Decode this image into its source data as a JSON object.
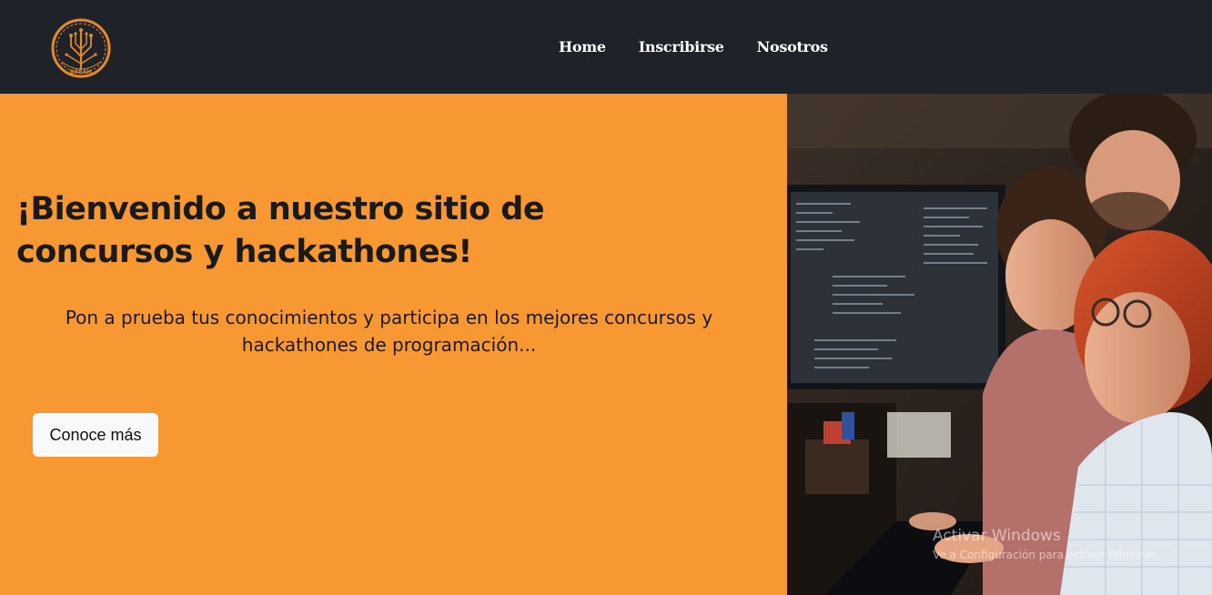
{
  "nav": {
    "logo_text": "DREAM",
    "links": [
      "Home",
      "Inscribirse",
      "Nosotros"
    ]
  },
  "hero": {
    "title": "¡Bienvenido a nuestro sitio de concursos y hackathones!",
    "subtitle": "Pon a prueba tus conocimientos y participa en los mejores concursos y hackathones de programación...",
    "cta_label": "Conoce más",
    "image_icon": "people-coding-photo"
  },
  "watermark": {
    "title": "Activar Windows",
    "subtitle": "Ve a Configuración para activar Windows."
  },
  "colors": {
    "navbar_bg": "#1f2329",
    "hero_bg": "#f89832",
    "logo_accent": "#e48a2b",
    "button_bg": "#f8f9fa"
  }
}
